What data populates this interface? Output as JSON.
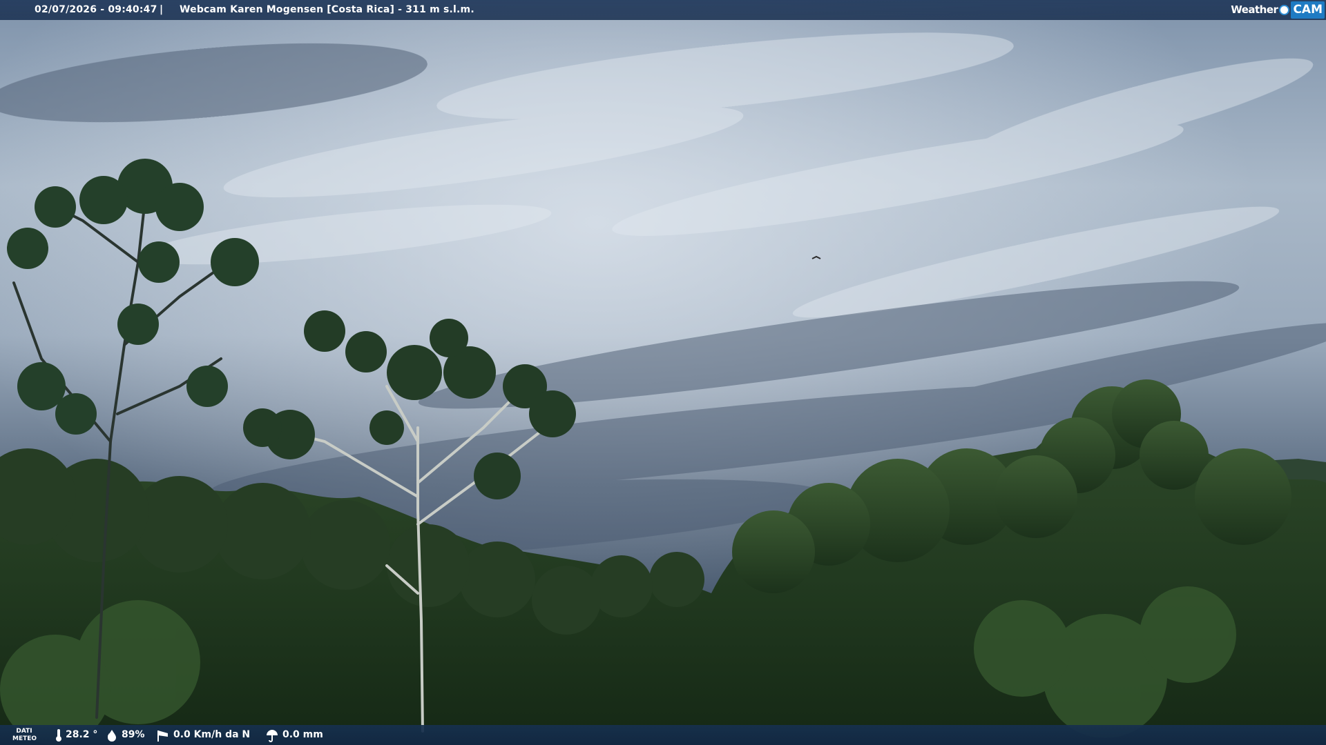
{
  "header": {
    "datetime": "02/07/2026 - 09:40:47",
    "separator": "|",
    "title": "Webcam Karen Mogensen [Costa Rica]  - 311 m s.l.m."
  },
  "logo": {
    "weather_text": "Weather",
    "cam_text": "CAM"
  },
  "weather_data": {
    "label_line1": "DATI",
    "label_line2": "METEO",
    "temperature": "28.2 °",
    "humidity": "89%",
    "wind": "0.0 Km/h da N",
    "rain": "0.0 mm"
  },
  "icons": {
    "temperature": "thermometer-icon",
    "humidity": "water-drop-icon",
    "wind": "wind-sock-icon",
    "rain": "rain-umbrella-icon"
  },
  "colors": {
    "bar_background": "#1f3a5c",
    "logo_accent": "#1f7bc3",
    "text": "#ffffff"
  }
}
